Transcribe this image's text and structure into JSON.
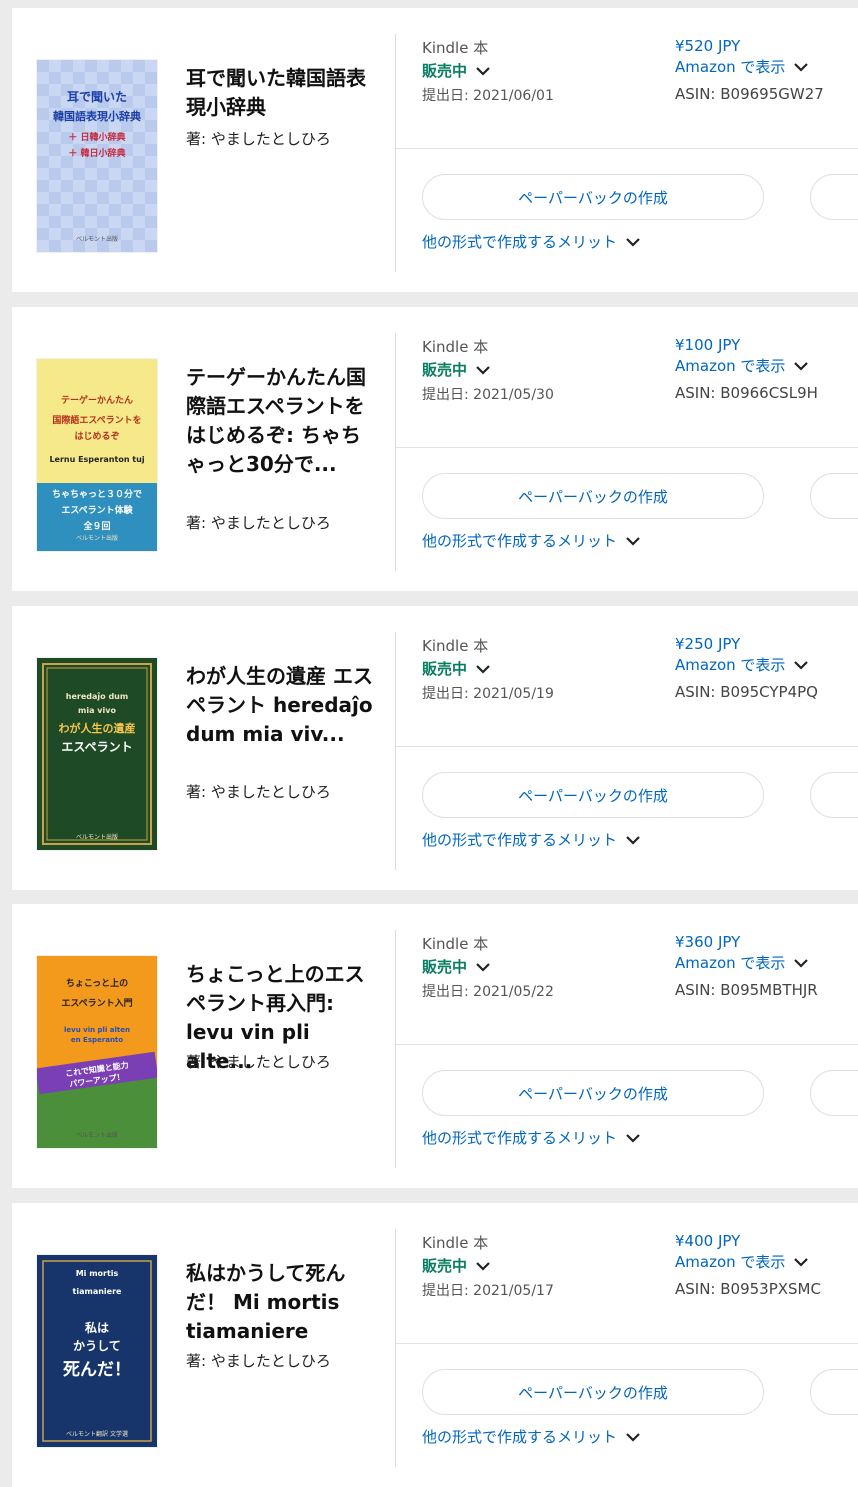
{
  "books": [
    {
      "title": "耳で聞いた韓国語表現小辞典",
      "author": "著: やましたとしひろ",
      "format": "Kindle 本",
      "status": "販売中",
      "submitted": "提出日: 2021/06/01",
      "price": "¥520 JPY",
      "amazon_link": "Amazon で表示",
      "asin": "ASIN: B09695GW27",
      "paperback_button": "ペーパーバックの作成",
      "other_formats_link": "他の形式で作成するメリット",
      "cover": {
        "bg": "#c9d7f2",
        "lines": [
          {
            "text": "耳で聞いた",
            "color": "#1b3fa6"
          },
          {
            "text": "韓国語表現小辞典",
            "color": "#1b3fa6"
          },
          {
            "text": "＋ 日韓小辞典",
            "color": "#c8283c"
          },
          {
            "text": "＋ 韓日小辞典",
            "color": "#c8283c"
          }
        ],
        "footer": "ベルモント出版"
      }
    },
    {
      "title": "テーゲーかんたん国際語エスペラントをはじめるぞ: ちゃちゃっと30分で...",
      "author": "著: やましたとしひろ",
      "format": "Kindle 本",
      "status": "販売中",
      "submitted": "提出日: 2021/05/30",
      "price": "¥100 JPY",
      "amazon_link": "Amazon で表示",
      "asin": "ASIN: B0966CSL9H",
      "paperback_button": "ペーパーバックの作成",
      "other_formats_link": "他の形式で作成するメリット",
      "cover": {
        "bg": "#f6e98a",
        "lines": [
          {
            "text": "テーゲーかんたん",
            "color": "#b5301c"
          },
          {
            "text": "国際語エスペラントを",
            "color": "#b5301c"
          },
          {
            "text": "はじめるぞ",
            "color": "#b5301c"
          },
          {
            "text": "Lernu Esperanton tuj",
            "color": "#222222"
          }
        ],
        "band_lines": [
          "ちゃちゃっと３０分で",
          "エスペラント体験",
          "全９回"
        ],
        "band_color": "#2f8fbf",
        "footer": "ベルモント出版"
      }
    },
    {
      "title": "わが人生の遺産 エスペラント heredaĵo dum mia viv...",
      "author": "著: やましたとしひろ",
      "format": "Kindle 本",
      "status": "販売中",
      "submitted": "提出日: 2021/05/19",
      "price": "¥250 JPY",
      "amazon_link": "Amazon で表示",
      "asin": "ASIN: B095CYP4PQ",
      "paperback_button": "ペーパーバックの作成",
      "other_formats_link": "他の形式で作成するメリット",
      "cover": {
        "bg": "#1f4a26",
        "lines": [
          {
            "text": "heredaĵo dum",
            "color": "#f1e6c4"
          },
          {
            "text": "mia vivo",
            "color": "#f1e6c4"
          },
          {
            "text": "わが人生の遺産",
            "color": "#f6c54a"
          },
          {
            "text": "エスペラント",
            "color": "#ffffff"
          }
        ],
        "footer": "ベルモント出版"
      }
    },
    {
      "title": "ちょこっと上のエスペラント再入門: levu vin pli alte...",
      "author": "著: やましたとしひろ",
      "format": "Kindle 本",
      "status": "販売中",
      "submitted": "提出日: 2021/05/22",
      "price": "¥360 JPY",
      "amazon_link": "Amazon で表示",
      "asin": "ASIN: B095MBTHJR",
      "paperback_button": "ペーパーバックの作成",
      "other_formats_link": "他の形式で作成するメリット",
      "cover": {
        "bg": "#f39a1c",
        "lines": [
          {
            "text": "ちょこっと上の",
            "color": "#222222"
          },
          {
            "text": "エスペラント入門",
            "color": "#222222"
          },
          {
            "text": "levu vin pli alten",
            "color": "#2a4fb0"
          },
          {
            "text": "en Esperanto",
            "color": "#2a4fb0"
          }
        ],
        "band_lines": [
          "これで知識と能力",
          "パワーアップ！"
        ],
        "band_color": "#7b3fb5",
        "lower_color": "#4b8f3a",
        "footer": "ベルモント出版"
      }
    },
    {
      "title": "私はかうして死んだ！ Mi mortis tiamaniere",
      "author": "著: やましたとしひろ",
      "format": "Kindle 本",
      "status": "販売中",
      "submitted": "提出日: 2021/05/17",
      "price": "¥400 JPY",
      "amazon_link": "Amazon で表示",
      "asin": "ASIN: B0953PXSMC",
      "paperback_button": "ペーパーバックの作成",
      "other_formats_link": "他の形式で作成するメリット",
      "cover": {
        "bg": "#17346b",
        "lines": [
          {
            "text": "Mi  mortis",
            "color": "#ffffff"
          },
          {
            "text": "tiamaniere",
            "color": "#ffffff"
          },
          {
            "text": "私は",
            "color": "#ffffff"
          },
          {
            "text": "かうして",
            "color": "#ffffff"
          },
          {
            "text": "死んだ！",
            "color": "#ffffff"
          }
        ],
        "footer": "ベルモント翻訳 文学選"
      }
    }
  ],
  "colors": {
    "link": "#0066c0",
    "status_green": "#067d62",
    "page_bg": "#ebebeb"
  }
}
